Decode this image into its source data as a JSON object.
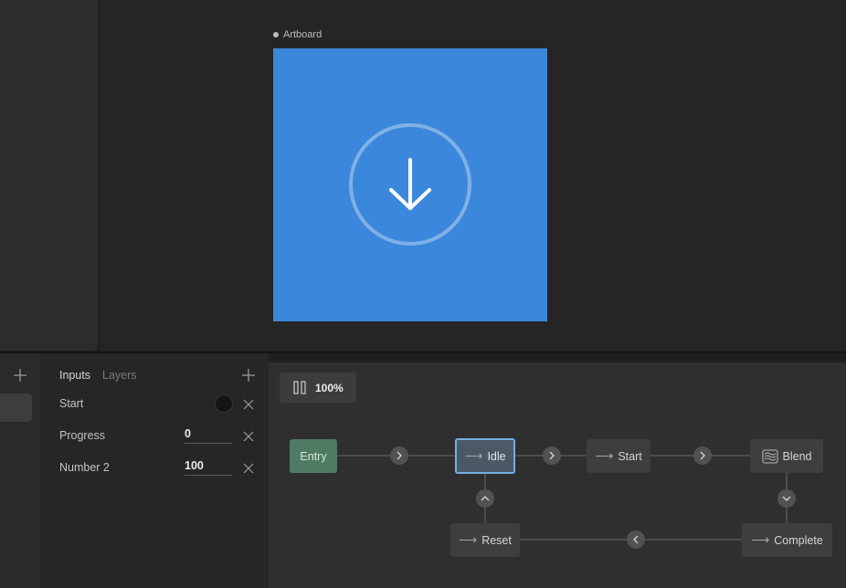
{
  "artboard": {
    "label": "Artboard",
    "fill": "#3b87db"
  },
  "inputs_panel": {
    "tabs": [
      {
        "label": "Inputs",
        "active": true
      },
      {
        "label": "Layers",
        "active": false
      }
    ],
    "items": [
      {
        "name": "Start",
        "type": "boolean",
        "value": ""
      },
      {
        "name": "Progress",
        "type": "number",
        "value": "0"
      },
      {
        "name": "Number 2",
        "type": "number",
        "value": "100"
      }
    ]
  },
  "graph": {
    "zoom": "100%",
    "nodes": {
      "entry": "Entry",
      "idle": "Idle",
      "start": "Start",
      "blend": "Blend",
      "reset": "Reset",
      "complete": "Complete"
    }
  },
  "icons": {
    "add": "plus-icon",
    "delete": "close-icon",
    "pause": "pause-icon",
    "transition_right": "chevron-right-icon",
    "transition_left": "chevron-left-icon",
    "transition_up": "chevron-up-icon",
    "transition_down": "chevron-down-icon",
    "state": "arrow-right-icon",
    "blend": "blend-icon",
    "download": "arrow-down-icon"
  },
  "colors": {
    "accent_selected": "#76aee4",
    "entry_node": "#4f7a63",
    "idle_node": "#4b5866"
  }
}
